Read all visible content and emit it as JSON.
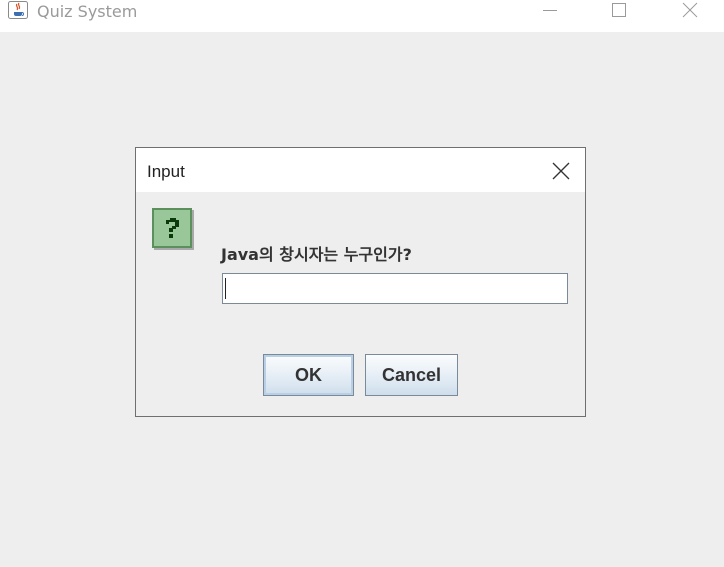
{
  "window": {
    "title": "Quiz System",
    "icon": "java-cup-icon",
    "controls": [
      "minimize-icon",
      "maximize-icon",
      "close-icon"
    ]
  },
  "dialog": {
    "title": "Input",
    "icon": "question-icon",
    "prompt": "Java의 창시자는 누구인가?",
    "input_value": "",
    "ok_label": "OK",
    "cancel_label": "Cancel"
  },
  "colors": {
    "background": "#eeeeee",
    "titlebar": "#ffffff",
    "question_icon_fill": "#99c799",
    "button_gradient_bottom": "#cfdeec"
  }
}
